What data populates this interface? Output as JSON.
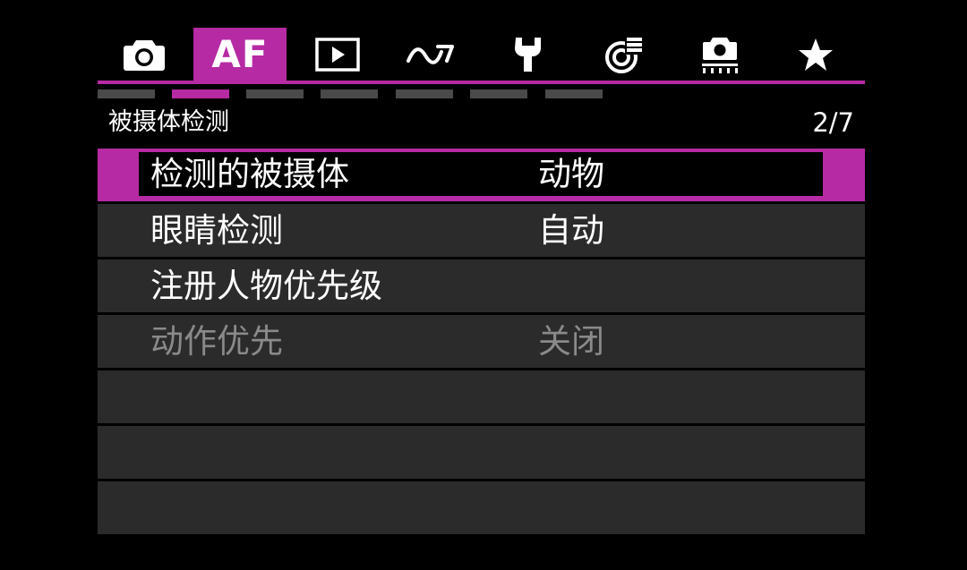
{
  "tabs": [
    {
      "id": "shooting",
      "icon": "camera-icon",
      "label": "",
      "active": false
    },
    {
      "id": "af",
      "icon": "af-icon",
      "label": "AF",
      "active": true
    },
    {
      "id": "playback",
      "icon": "playback-icon",
      "label": "",
      "active": false
    },
    {
      "id": "custom",
      "icon": "wave-icon",
      "label": "",
      "active": false
    },
    {
      "id": "setup",
      "icon": "wrench-icon",
      "label": "",
      "active": false
    },
    {
      "id": "network",
      "icon": "network-icon",
      "label": "",
      "active": false
    },
    {
      "id": "camera-settings",
      "icon": "camera-settings-icon",
      "label": "",
      "active": false
    },
    {
      "id": "my-menu",
      "icon": "star-icon",
      "label": "",
      "active": false
    }
  ],
  "page_indicators": {
    "total": 7,
    "active_index": 1
  },
  "menu": {
    "title": "被摄体检测",
    "page": "2/7",
    "items": [
      {
        "label": "检测的被摄体",
        "value": "动物",
        "selected": true,
        "disabled": false
      },
      {
        "label": "眼睛检测",
        "value": "自动",
        "selected": false,
        "disabled": false
      },
      {
        "label": "注册人物优先级",
        "value": "",
        "selected": false,
        "disabled": false
      },
      {
        "label": "动作优先",
        "value": "关闭",
        "selected": false,
        "disabled": true
      },
      {
        "label": "",
        "value": "",
        "selected": false,
        "disabled": false
      },
      {
        "label": "",
        "value": "",
        "selected": false,
        "disabled": false
      },
      {
        "label": "",
        "value": "",
        "selected": false,
        "disabled": false
      }
    ]
  },
  "colors": {
    "accent": "#b62aa3",
    "row_bg": "#2b2b2b",
    "disabled_text": "#8a8a8a",
    "indicator": "#4a4a4a"
  }
}
